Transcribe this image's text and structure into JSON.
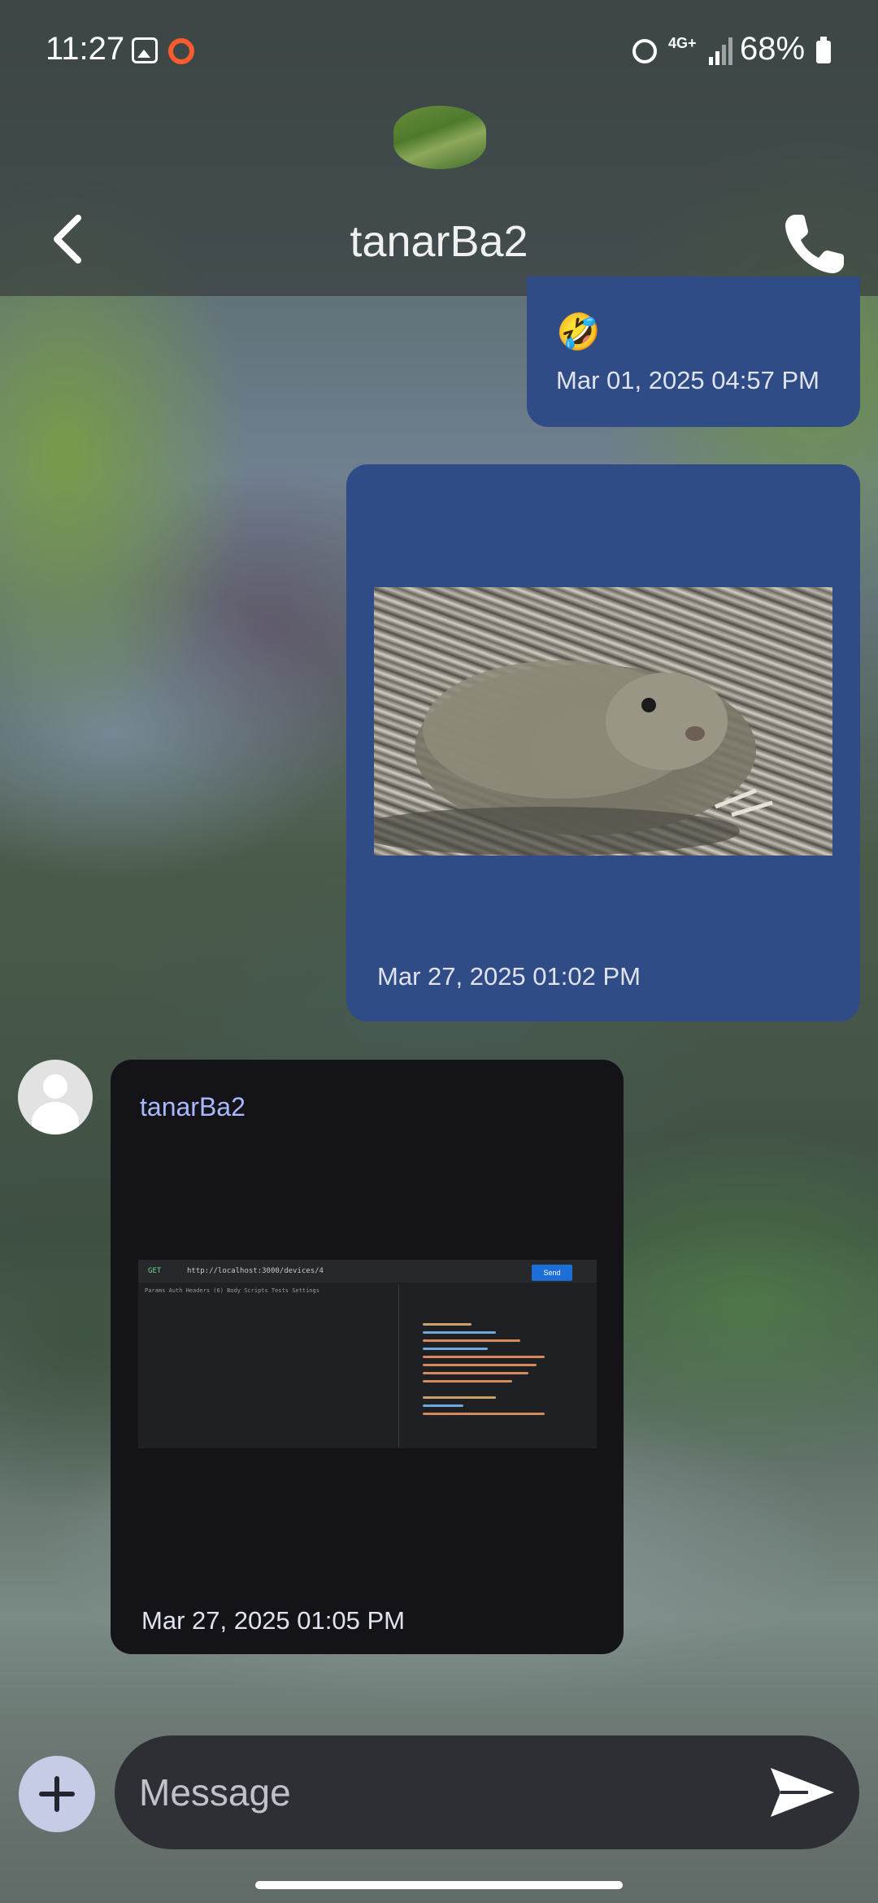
{
  "status_bar": {
    "time": "11:27",
    "network": "4G+",
    "battery": "68%",
    "icons": [
      "gallery-icon",
      "record-icon",
      "alarm-icon",
      "signal-icon",
      "battery-icon"
    ]
  },
  "header": {
    "title": "tanarBa2",
    "back_icon": "chevron-left-icon",
    "call_icon": "phone-icon"
  },
  "messages": [
    {
      "direction": "outgoing",
      "emoji": "🤣",
      "timestamp": "Mar 01, 2025 04:57 PM"
    },
    {
      "direction": "outgoing",
      "image": "ground squirrel photo",
      "timestamp": "Mar 27, 2025 01:02 PM"
    },
    {
      "direction": "incoming",
      "sender": "tanarBa2",
      "image": "api client screenshot",
      "timestamp": "Mar 27, 2025 01:05 PM"
    }
  ],
  "screenshot_text": {
    "method": "GET",
    "url": "http://localhost:3000/devices/4",
    "send": "Send",
    "tabs": "Params  Auth  Headers (6)  Body  Scripts  Tests  Settings"
  },
  "composer": {
    "placeholder": "Message",
    "value": ""
  },
  "colors": {
    "outgoing_bubble": "#2f4c86",
    "incoming_bubble": "#141418",
    "sender_name": "#a9b9ff"
  }
}
